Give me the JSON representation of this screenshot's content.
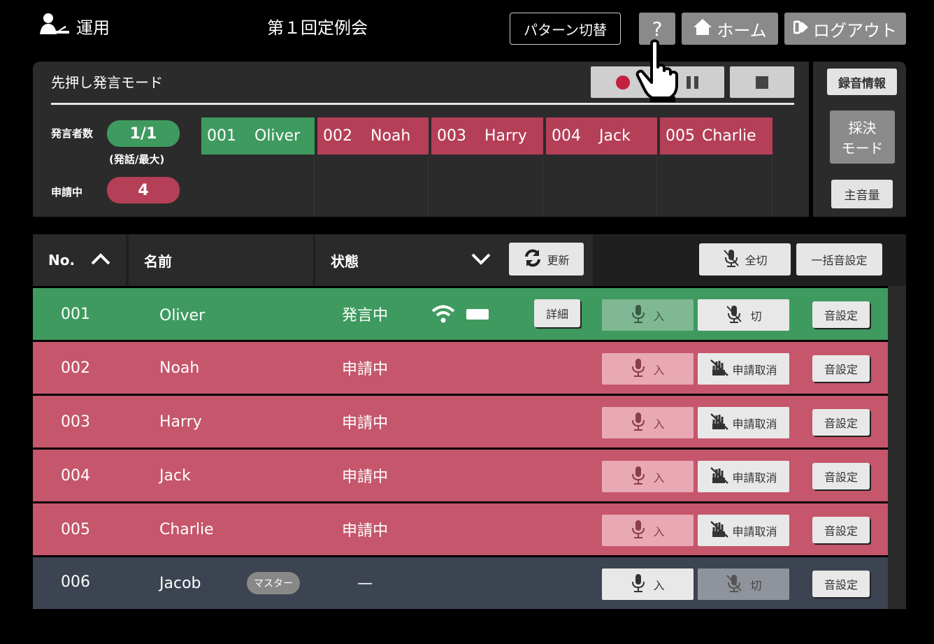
{
  "header": {
    "mode_label": "運用",
    "title": "第１回定例会",
    "pattern_button": "パターン切替",
    "help_button": "?",
    "home_button": "ホーム",
    "logout_button": "ログアウト"
  },
  "panel": {
    "title": "先押し発言モード",
    "speaker_count_label": "発言者数",
    "speaker_count_value": "1/1",
    "speaker_count_note": "(発話/最大)",
    "requesting_label": "申請中",
    "requesting_value": "4",
    "slots": [
      {
        "no": "001",
        "name": "Oliver",
        "state": "speaking"
      },
      {
        "no": "002",
        "name": "Noah",
        "state": "requesting"
      },
      {
        "no": "003",
        "name": "Harry",
        "state": "requesting"
      },
      {
        "no": "004",
        "name": "Jack",
        "state": "requesting"
      },
      {
        "no": "005",
        "name": "Charlie",
        "state": "requesting"
      }
    ]
  },
  "side": {
    "rec_info": "録音情報",
    "vote_mode_line1": "採決",
    "vote_mode_line2": "モード",
    "main_volume": "主音量"
  },
  "table": {
    "col_no": "No.",
    "col_name": "名前",
    "col_state": "状態",
    "refresh": "更新",
    "all_off": "全切",
    "bulk_sound": "一括音設定",
    "rows": [
      {
        "no": "001",
        "name": "Oliver",
        "state": "発言中",
        "detail": "詳細",
        "mic_on": "入",
        "mic_off": "切",
        "sound": "音設定"
      },
      {
        "no": "002",
        "name": "Noah",
        "state": "申請中",
        "mic_on": "入",
        "cancel": "申請取消",
        "sound": "音設定"
      },
      {
        "no": "003",
        "name": "Harry",
        "state": "申請中",
        "mic_on": "入",
        "cancel": "申請取消",
        "sound": "音設定"
      },
      {
        "no": "004",
        "name": "Jack",
        "state": "申請中",
        "mic_on": "入",
        "cancel": "申請取消",
        "sound": "音設定"
      },
      {
        "no": "005",
        "name": "Charlie",
        "state": "申請中",
        "mic_on": "入",
        "cancel": "申請取消",
        "sound": "音設定"
      },
      {
        "no": "006",
        "name": "Jacob",
        "badge": "マスター",
        "state": "—",
        "mic_on": "入",
        "mic_off": "切",
        "sound": "音設定"
      }
    ]
  },
  "colors": {
    "speaking": "#3e9a5f",
    "requesting": "#c5566c",
    "idle": "#3c4351",
    "panel": "#2b2b2b"
  }
}
